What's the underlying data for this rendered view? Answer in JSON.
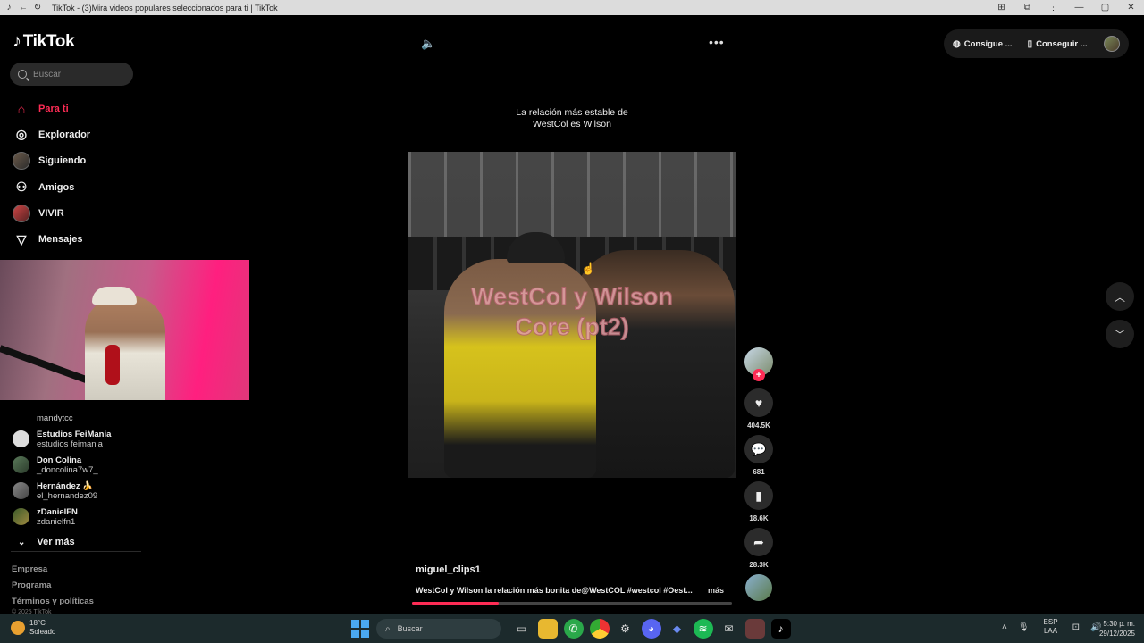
{
  "window": {
    "title": "TikTok - (3)Mira videos populares seleccionados para ti | TikTok",
    "controls": [
      "—",
      "▢",
      "✕"
    ]
  },
  "brand": {
    "logo_text": "TikTok",
    "accent": "#fe2c55"
  },
  "search": {
    "placeholder": "Buscar"
  },
  "nav": {
    "items": [
      {
        "label": "Para ti",
        "icon": "home-icon",
        "active": true
      },
      {
        "label": "Explorador",
        "icon": "compass-icon"
      },
      {
        "label": "Siguiendo",
        "icon": "avatar"
      },
      {
        "label": "Amigos",
        "icon": "people-icon"
      },
      {
        "label": "VIVIR",
        "icon": "avatar"
      },
      {
        "label": "Mensajes",
        "icon": "send-icon"
      }
    ]
  },
  "following": {
    "first_user": "mandytcc",
    "accounts": [
      {
        "name": "Estudios FeiMania",
        "user": "estudios feimania"
      },
      {
        "name": "Don Colina",
        "user": "_doncolina7w7_"
      },
      {
        "name": "Hernández 🍌",
        "user": "el_hernandez09"
      },
      {
        "name": "zDanielFN",
        "user": "zdanielfn1"
      }
    ],
    "see_more": "Ver más"
  },
  "footer": {
    "links": [
      "Empresa",
      "Programa",
      "Términos y políticas"
    ],
    "copyright": "© 2025 TikTok"
  },
  "top_actions": {
    "coins": "Consigue ...",
    "app": "Conseguir ..."
  },
  "video": {
    "caption_line1": "La relación más estable de",
    "caption_line2": "WestCol es Wilson",
    "overlay_line1": "WestCol y Wilson",
    "overlay_line2": "Core (pt2)",
    "author": "miguel_clips1",
    "description": "WestCol y Wilson la relación más bonita de@WestCOL #westcol #Oest...",
    "more": "más",
    "progress": 0.27
  },
  "actions": {
    "likes": "404.5K",
    "comments": "681",
    "saves": "18.6K",
    "shares": "28.3K"
  },
  "taskbar": {
    "weather_temp": "18°C",
    "weather_desc": "Soleado",
    "search_placeholder": "Buscar",
    "lang_line1": "ESP",
    "lang_line2": "LAA",
    "time": "5:30 p. m.",
    "date": "29/12/2025"
  }
}
